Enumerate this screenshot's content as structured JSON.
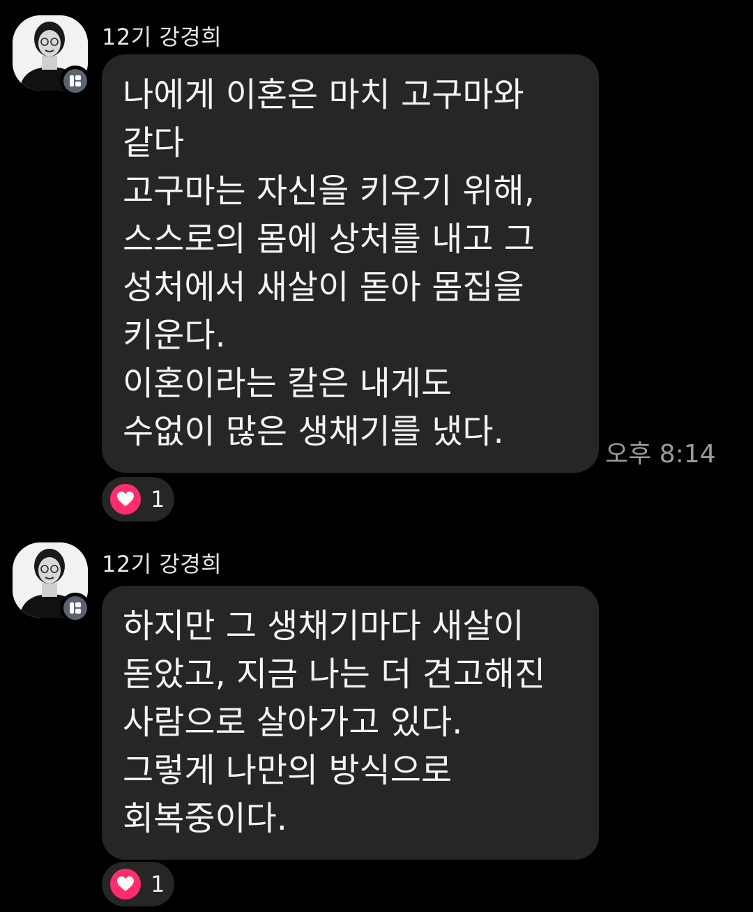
{
  "colors": {
    "background": "#000000",
    "bubble": "#262626",
    "heart": "#ff2d6b",
    "badge": "#5b6270",
    "time_text": "#9a9a9a"
  },
  "messages": [
    {
      "sender": "12기 강경희",
      "text": "나에게 이혼은 마치 고구마와\n같다\n고구마는 자신을 키우기 위해,\n스스로의 몸에 상처를 내고 그\n성처에서 새살이 돋아 몸집을\n키운다.\n이혼이라는 칼은 내게도\n수없이 많은 생채기를 냈다.",
      "time": "오후 8:14",
      "reaction_icon": "heart-icon",
      "reaction_count": "1"
    },
    {
      "sender": "12기 강경희",
      "text": "하지만 그 생채기마다 새살이\n돋았고, 지금 나는 더 견고해진\n사람으로 살아가고 있다.\n그렇게 나만의 방식으로\n회복중이다.",
      "reaction_icon": "heart-icon",
      "reaction_count": "1"
    }
  ]
}
